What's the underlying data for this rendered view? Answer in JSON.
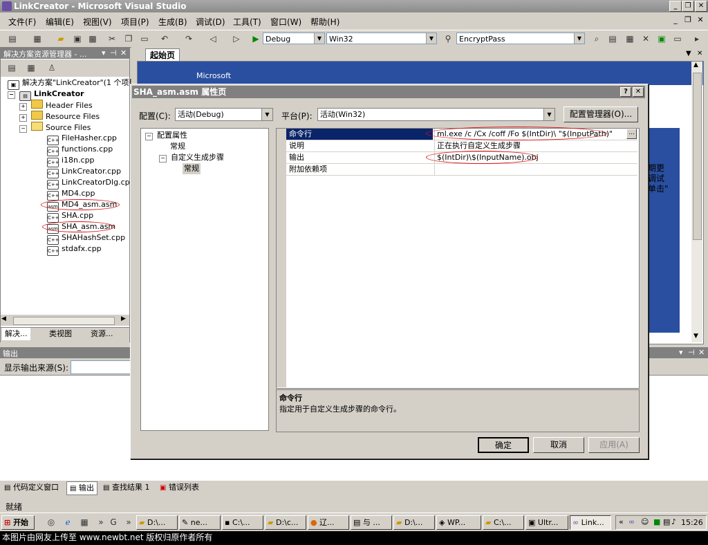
{
  "window": {
    "title": "LinkCreator - Microsoft Visual Studio"
  },
  "menu": [
    "文件(F)",
    "编辑(E)",
    "视图(V)",
    "项目(P)",
    "生成(B)",
    "调试(D)",
    "工具(T)",
    "窗口(W)",
    "帮助(H)"
  ],
  "toolbar": {
    "config": "Debug",
    "platform": "Win32",
    "find": "EncryptPass"
  },
  "solution_explorer": {
    "title": "解决方案资源管理器 - ...",
    "solution": "解决方案\"LinkCreator\"(1 个项目",
    "project": "LinkCreator",
    "folders": [
      "Header Files",
      "Resource Files",
      "Source Files"
    ],
    "files": [
      "FileHasher.cpp",
      "functions.cpp",
      "i18n.cpp",
      "LinkCreator.cpp",
      "LinkCreatorDlg.cpp",
      "MD4.cpp",
      "MD4_asm.asm",
      "SHA.cpp",
      "SHA_asm.asm",
      "SHAHashSet.cpp",
      "stdafx.cpp"
    ],
    "tabs": [
      "解决...",
      "类视图",
      "资源..."
    ]
  },
  "start_page": {
    "tab": "起始页",
    "logo": "Microsoft",
    "snippets": [
      "期更",
      "调试",
      "单击\""
    ]
  },
  "output": {
    "title": "输出",
    "source_label": "显示输出来源(S):"
  },
  "bottom_tabs": [
    "代码定义窗口",
    "输出",
    "查找结果 1",
    "错误列表"
  ],
  "status": "就绪",
  "taskbar": {
    "start": "开始",
    "items": [
      "D:\\...",
      "ne...",
      "C:\\...",
      "D:\\c...",
      "辽...",
      "与 ...",
      "D:\\...",
      "WP...",
      "C:\\...",
      "Ultr...",
      "Link..."
    ],
    "quick": "G",
    "time": "15:26"
  },
  "caption": "本图片由网友上传至 www.newbt.net 版权归原作者所有",
  "dialog": {
    "title": "SHA_asm.asm 属性页",
    "config_label": "配置(C):",
    "config_value": "活动(Debug)",
    "platform_label": "平台(P):",
    "platform_value": "活动(Win32)",
    "config_manager": "配置管理器(O)...",
    "tree": {
      "root": "配置属性",
      "general": "常规",
      "custom": "自定义生成步骤",
      "custom_general": "常规"
    },
    "rows": [
      {
        "name": "命令行",
        "value": "ml.exe /c /Cx /coff /Fo $(IntDir)\\ \"$(InputPath)\""
      },
      {
        "name": "说明",
        "value": "正在执行自定义生成步骤"
      },
      {
        "name": "输出",
        "value": "$(IntDir)\\$(InputName).obj"
      },
      {
        "name": "附加依赖项",
        "value": ""
      }
    ],
    "desc_title": "命令行",
    "desc_text": "指定用于自定义生成步骤的命令行。",
    "ok": "确定",
    "cancel": "取消",
    "apply": "应用(A)"
  },
  "colors": {
    "selection": "#0a246a",
    "annotation": "#dd1111"
  }
}
